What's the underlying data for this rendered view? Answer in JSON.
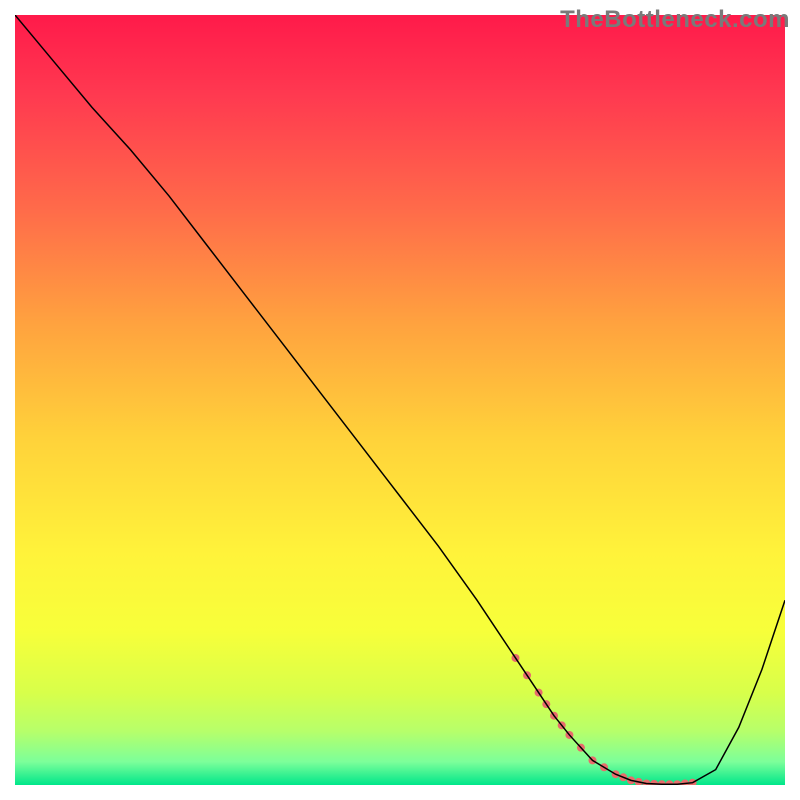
{
  "watermark": "TheBottleneck.com",
  "chart_data": {
    "type": "line",
    "title": "",
    "xlabel": "",
    "ylabel": "",
    "xlim": [
      0,
      100
    ],
    "ylim": [
      0,
      100
    ],
    "grid": false,
    "legend": false,
    "gradient_stops": [
      {
        "offset": 0.0,
        "color": "#ff1a4a"
      },
      {
        "offset": 0.1,
        "color": "#ff3850"
      },
      {
        "offset": 0.25,
        "color": "#ff6a4a"
      },
      {
        "offset": 0.4,
        "color": "#ffa23f"
      },
      {
        "offset": 0.55,
        "color": "#ffd23a"
      },
      {
        "offset": 0.7,
        "color": "#fff33a"
      },
      {
        "offset": 0.8,
        "color": "#f7ff3a"
      },
      {
        "offset": 0.88,
        "color": "#d8ff4a"
      },
      {
        "offset": 0.93,
        "color": "#b7ff6a"
      },
      {
        "offset": 0.97,
        "color": "#7cff9a"
      },
      {
        "offset": 1.0,
        "color": "#00e68a"
      }
    ],
    "series": [
      {
        "name": "curve",
        "stroke": "#000000",
        "stroke_width": 1.5,
        "x": [
          0,
          5,
          10,
          15,
          20,
          25,
          30,
          35,
          40,
          45,
          50,
          55,
          60,
          62,
          65,
          68,
          70,
          72,
          75,
          78,
          80,
          82,
          84,
          86,
          88,
          91,
          94,
          97,
          100
        ],
        "y": [
          100,
          94,
          88,
          82.5,
          76.5,
          70,
          63.5,
          57,
          50.5,
          44,
          37.5,
          31,
          24,
          21,
          16.5,
          12,
          9,
          6.5,
          3.2,
          1.4,
          0.6,
          0.2,
          0.1,
          0.1,
          0.3,
          2.0,
          7.5,
          15,
          24
        ]
      },
      {
        "name": "highlight",
        "stroke": "#e86c6c",
        "stroke_width": 8,
        "linecap": "round",
        "x": [
          65,
          68,
          70,
          72,
          75,
          78,
          80,
          82,
          84,
          86,
          88
        ],
        "y": [
          16.5,
          12,
          9,
          6.5,
          3.2,
          1.4,
          0.6,
          0.2,
          0.1,
          0.1,
          0.3
        ],
        "dotted": true
      }
    ]
  }
}
